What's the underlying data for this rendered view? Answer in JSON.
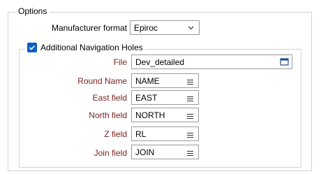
{
  "options": {
    "title": "Options",
    "manufacturer_format_label": "Manufacturer format",
    "manufacturer_format_value": "Epiroc"
  },
  "navigation": {
    "checkbox_label": "Additional Navigation Holes",
    "checked": true,
    "file_label": "File",
    "file_value": "Dev_detailed",
    "fields": [
      {
        "label": "Round Name",
        "value": "NAME"
      },
      {
        "label": "East field",
        "value": "EAST"
      },
      {
        "label": "North field",
        "value": "NORTH"
      },
      {
        "label": "Z field",
        "value": "RL"
      },
      {
        "label": "Join field",
        "value": "JOIN"
      }
    ]
  },
  "colors": {
    "accent": "#0a5fc4",
    "field_label": "#7a1f1f"
  },
  "icons": {
    "dropdown": "chevron-down-icon",
    "file_browse": "file-browse-icon",
    "field_list": "list-icon"
  }
}
